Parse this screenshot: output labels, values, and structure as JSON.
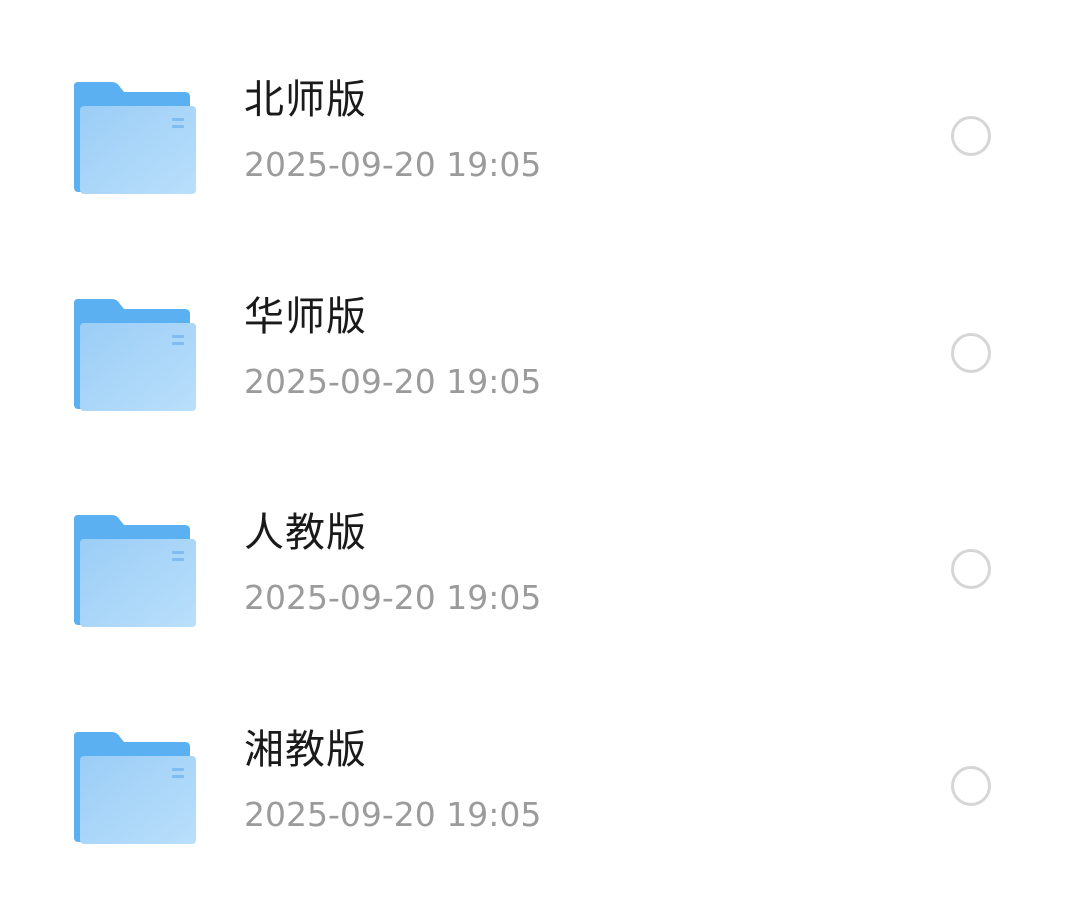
{
  "icons": {
    "folder": "folder-icon",
    "select": "radio-circle-icon"
  },
  "colors": {
    "folder_light": "#a9d6f8",
    "folder_dark": "#5ab0f0",
    "name_text": "#1a1a1a",
    "date_text": "#9b9b9b",
    "radio_border": "#d6d6d6"
  },
  "files": [
    {
      "name": "北师版",
      "date": "2025-09-20 19:05",
      "selected": false
    },
    {
      "name": "华师版",
      "date": "2025-09-20 19:05",
      "selected": false
    },
    {
      "name": "人教版",
      "date": "2025-09-20 19:05",
      "selected": false
    },
    {
      "name": "湘教版",
      "date": "2025-09-20 19:05",
      "selected": false
    }
  ]
}
